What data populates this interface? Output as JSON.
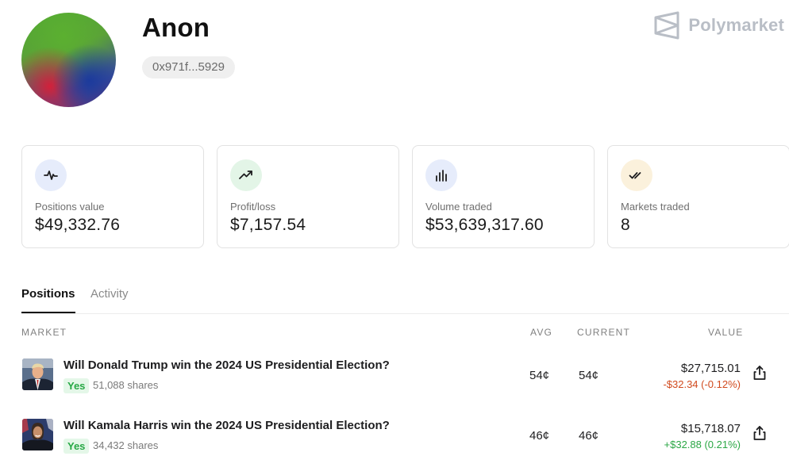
{
  "profile": {
    "name": "Anon",
    "address": "0x971f...5929"
  },
  "brand": {
    "name": "Polymarket",
    "icon": "polymarket-logo-icon"
  },
  "stats": [
    {
      "label": "Positions value",
      "value": "$49,332.76",
      "icon": "pulse-icon",
      "icon_bg": "#e6ecfb",
      "icon_color": "#1d1d1f"
    },
    {
      "label": "Profit/loss",
      "value": "$7,157.54",
      "icon": "trend-up-icon",
      "icon_bg": "#e3f5e7",
      "icon_color": "#1d1d1f"
    },
    {
      "label": "Volume traded",
      "value": "$53,639,317.60",
      "icon": "bar-chart-icon",
      "icon_bg": "#e6ecfb",
      "icon_color": "#1d1d1f"
    },
    {
      "label": "Markets traded",
      "value": "8",
      "icon": "double-check-icon",
      "icon_bg": "#fbf1dc",
      "icon_color": "#1d1d1f"
    }
  ],
  "tabs": [
    {
      "label": "Positions",
      "active": true
    },
    {
      "label": "Activity",
      "active": false
    }
  ],
  "table": {
    "headers": {
      "market": "MARKET",
      "avg": "AVG",
      "current": "CURRENT",
      "value": "VALUE"
    },
    "rows": [
      {
        "question": "Will Donald Trump win the 2024 US Presidential Election?",
        "outcome": "Yes",
        "shares": "51,088 shares",
        "avg": "54¢",
        "current": "54¢",
        "value": "$27,715.01",
        "change": "-$32.34 (-0.12%)",
        "change_direction": "down"
      },
      {
        "question": "Will Kamala Harris win the 2024 US Presidential Election?",
        "outcome": "Yes",
        "shares": "34,432 shares",
        "avg": "46¢",
        "current": "46¢",
        "value": "$15,718.07",
        "change": "+$32.88 (0.21%)",
        "change_direction": "up"
      }
    ]
  },
  "colors": {
    "positive": "#2ba745",
    "negative": "#d14a1e",
    "pill_bg": "#e4f7e8"
  }
}
